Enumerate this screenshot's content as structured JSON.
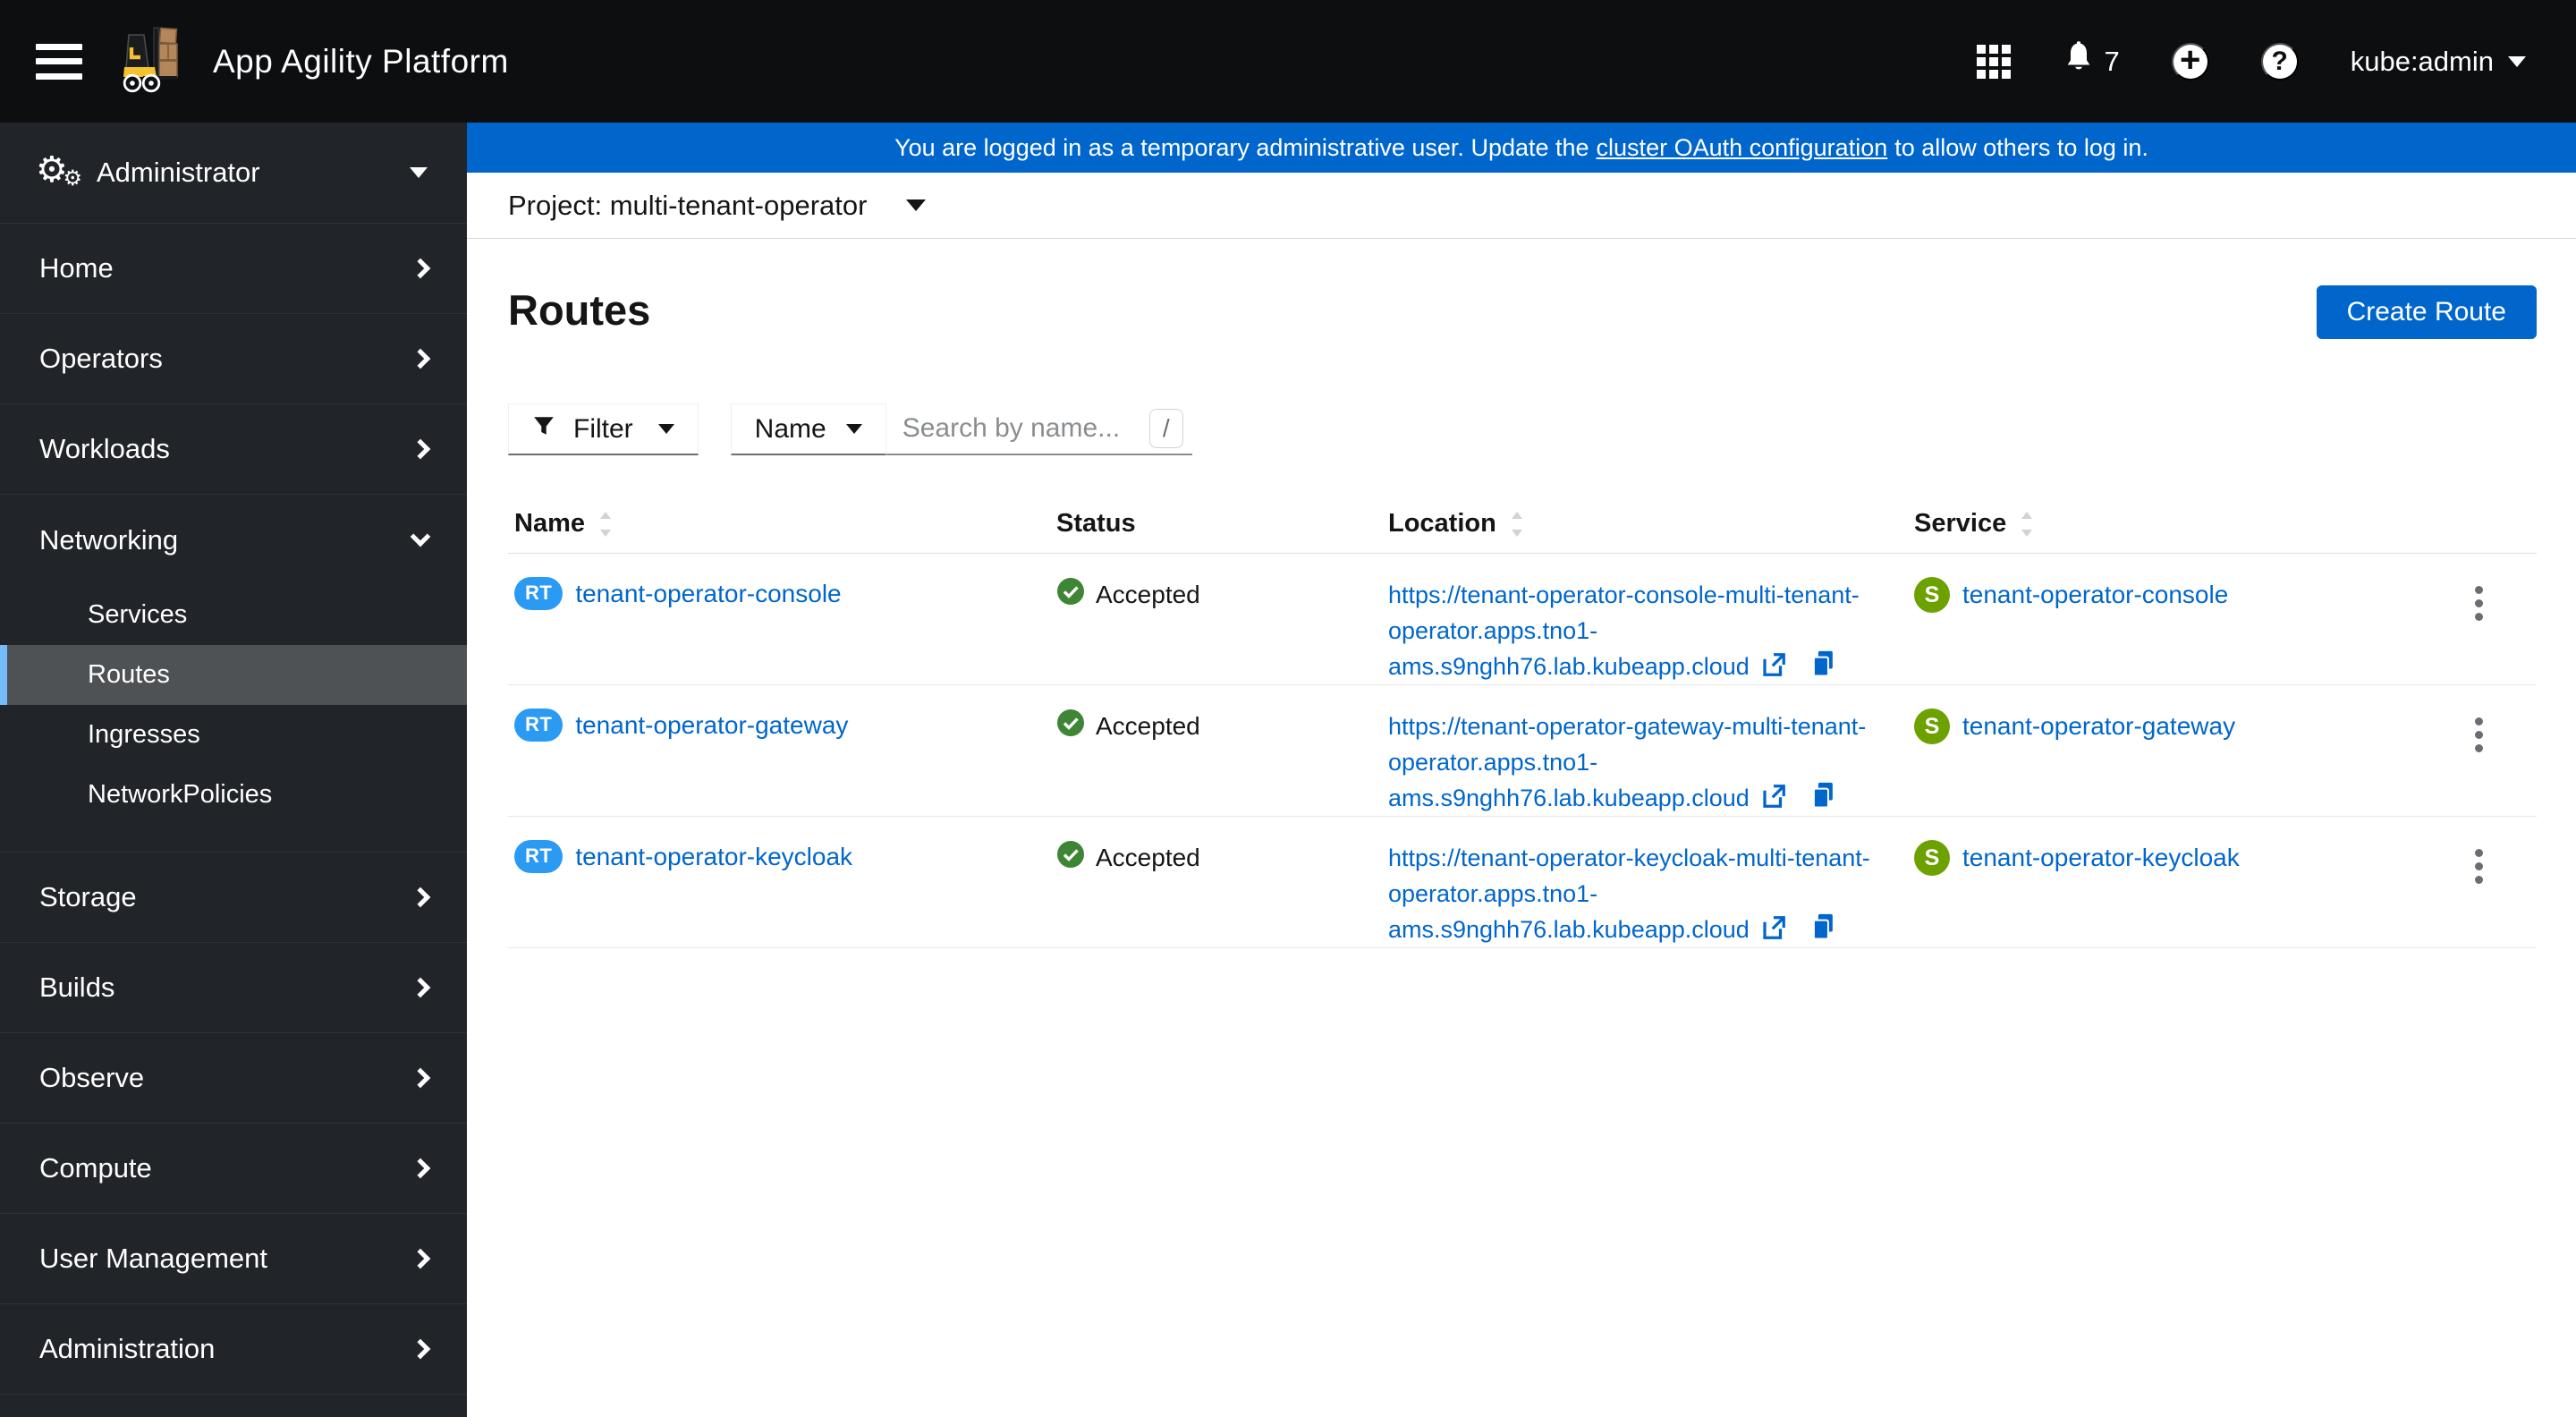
{
  "masthead": {
    "title": "App Agility Platform",
    "notification_count": "7",
    "user": "kube:admin",
    "icons": [
      "menu-icon",
      "app-launcher-icon",
      "bell-icon",
      "plus-circle-icon",
      "help-icon",
      "caret-down-icon"
    ]
  },
  "banner": {
    "text_before": "You are logged in as a temporary administrative user. Update the",
    "link_text": "cluster OAuth configuration",
    "text_after": "to allow others to log in."
  },
  "project_bar": {
    "label": "Project: multi-tenant-operator"
  },
  "sidebar": {
    "perspective": "Administrator",
    "items": [
      {
        "label": "Home"
      },
      {
        "label": "Operators"
      },
      {
        "label": "Workloads"
      },
      {
        "label": "Networking",
        "expanded": true
      },
      {
        "label": "Storage"
      },
      {
        "label": "Builds"
      },
      {
        "label": "Observe"
      },
      {
        "label": "Compute"
      },
      {
        "label": "User Management"
      },
      {
        "label": "Administration"
      }
    ],
    "networking_children": [
      {
        "label": "Services",
        "active": false
      },
      {
        "label": "Routes",
        "active": true
      },
      {
        "label": "Ingresses",
        "active": false
      },
      {
        "label": "NetworkPolicies",
        "active": false
      }
    ]
  },
  "page": {
    "title": "Routes",
    "create_button": "Create Route",
    "toolbar": {
      "filter_label": "Filter",
      "attribute_label": "Name",
      "search_placeholder": "Search by name...",
      "search_value": "",
      "shortcut_hint": "/"
    },
    "table": {
      "columns": {
        "name": "Name",
        "status": "Status",
        "location": "Location",
        "service": "Service"
      },
      "rows": [
        {
          "badge": "RT",
          "name": "tenant-operator-console",
          "status": "Accepted",
          "location": "https://tenant-operator-console-multi-tenant-operator.apps.tno1-ams.s9nghh76.lab.kubeapp.cloud",
          "service_badge": "S",
          "service": "tenant-operator-console"
        },
        {
          "badge": "RT",
          "name": "tenant-operator-gateway",
          "status": "Accepted",
          "location": "https://tenant-operator-gateway-multi-tenant-operator.apps.tno1-ams.s9nghh76.lab.kubeapp.cloud",
          "service_badge": "S",
          "service": "tenant-operator-gateway"
        },
        {
          "badge": "RT",
          "name": "tenant-operator-keycloak",
          "status": "Accepted",
          "location": "https://tenant-operator-keycloak-multi-tenant-operator.apps.tno1-ams.s9nghh76.lab.kubeapp.cloud",
          "service_badge": "S",
          "service": "tenant-operator-keycloak"
        }
      ]
    }
  },
  "colors": {
    "masthead_bg": "#0d0e10",
    "sidebar_bg": "#212428",
    "banner_blue": "#0066cc",
    "link_blue": "#0066cc",
    "route_badge_blue": "#2b9af3",
    "service_badge_green": "#6ca100",
    "status_check_green": "#3e8635",
    "active_nav_indicator": "#73bcf7",
    "active_nav_bg": "#4f5255"
  }
}
